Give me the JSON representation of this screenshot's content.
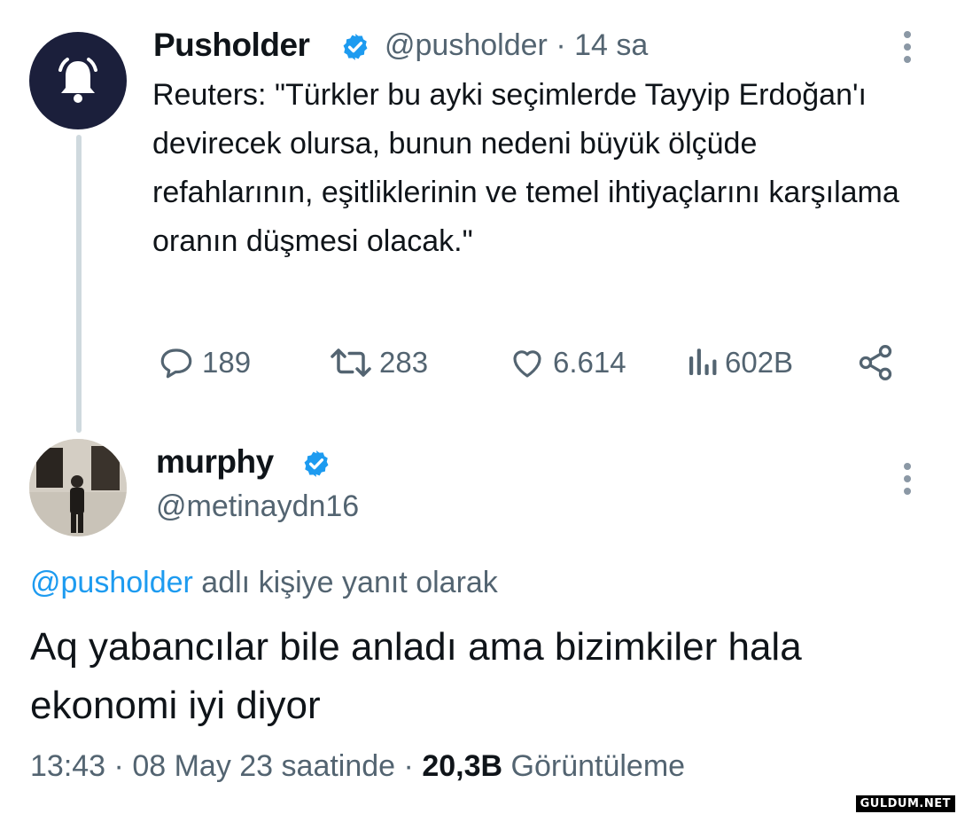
{
  "original_tweet": {
    "author_name": "Pusholder",
    "author_handle": "@pusholder",
    "separator": "·",
    "time_ago": "14 sa",
    "text": "Reuters: \"Türkler bu ayki seçimlerde Tayyip Erdoğan'ı devirecek olursa, bunun nedeni büyük ölçüde refahlarının, eşitliklerinin ve temel ihtiyaçlarını karşılama oranın düşmesi olacak.\"",
    "stats": {
      "replies": "189",
      "retweets": "283",
      "likes": "6.614",
      "views": "602B"
    },
    "avatar_icon": "bell-icon"
  },
  "reply_tweet": {
    "author_name": "murphy",
    "author_handle": "@metinaydn16",
    "reply_to_mention": "@pusholder",
    "reply_to_suffix": " adlı kişiye yanıt olarak",
    "text": "Aq yabancılar bile anladı ama bizimkiler hala ekonomi iyi diyor",
    "time": "13:43",
    "date": "08 May 23 saatinde",
    "separator": "·",
    "views_count": "20,3B",
    "views_label": "Görüntüleme"
  },
  "watermark": "GULDUM.NET",
  "colors": {
    "accent": "#1d9bf0",
    "text": "#0f1419",
    "muted": "#536471",
    "thread_line": "#cfd9de",
    "avatar_bg": "#1b1f3b"
  }
}
